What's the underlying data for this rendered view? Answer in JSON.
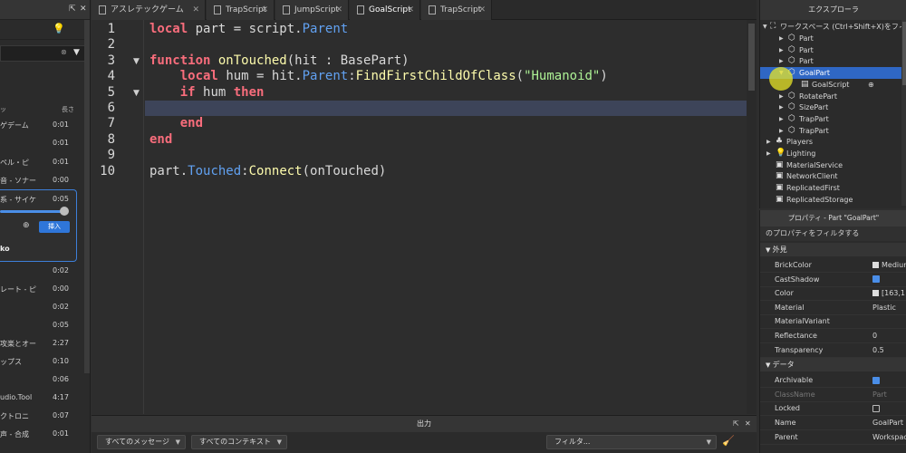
{
  "assets_panel": {
    "lightbulb_icon": "lightbulb-icon",
    "column_duration_header": "長さ",
    "column_left_header": "ッ",
    "rows": [
      {
        "title": "ゲデーム",
        "duration": "0:01"
      },
      {
        "title": "",
        "duration": "0:01"
      },
      {
        "title": "ペル・ピ",
        "duration": "0:01"
      },
      {
        "title": "音 - ソナー",
        "duration": "0:00"
      },
      {
        "title": "系 - サイケ",
        "duration": "0:05"
      }
    ],
    "selected": {
      "insert_label": "挿入",
      "author": "ko",
      "volume_fraction": 0.92
    },
    "rows_after": [
      {
        "title": "",
        "duration": "0:02"
      },
      {
        "title": "レート - ピ",
        "duration": "0:00"
      },
      {
        "title": "",
        "duration": "0:02"
      },
      {
        "title": "",
        "duration": "0:05"
      },
      {
        "title": "攻楽とオー",
        "duration": "2:27"
      },
      {
        "title": "ップス",
        "duration": "0:10"
      },
      {
        "title": "",
        "duration": "0:06"
      },
      {
        "title": "udio.Tool",
        "duration": "4:17"
      },
      {
        "title": "クトロニ",
        "duration": "0:07"
      },
      {
        "title": "声 - 合成",
        "duration": "0:01"
      }
    ]
  },
  "tabs": [
    {
      "label": "アスレテックゲーム",
      "icon": "game-icon",
      "active": false
    },
    {
      "label": "TrapScript",
      "icon": "script-icon",
      "active": false
    },
    {
      "label": "JumpScript",
      "icon": "script-icon",
      "active": false
    },
    {
      "label": "GoalScript",
      "icon": "script-icon",
      "active": true
    },
    {
      "label": "TrapScript",
      "icon": "script-icon",
      "active": false
    }
  ],
  "editor": {
    "current_line": 6,
    "line_numbers": [
      "1",
      "2",
      "3",
      "4",
      "5",
      "6",
      "7",
      "8",
      "9",
      "10"
    ],
    "lines": [
      {
        "tokens": [
          [
            "kw",
            "local"
          ],
          [
            "",
            "part = script."
          ],
          [
            "pr",
            "Parent"
          ]
        ]
      },
      {
        "tokens": []
      },
      {
        "tokens": [
          [
            "kw",
            "function"
          ],
          [
            "",
            ""
          ],
          [
            "fn",
            "onTouched"
          ],
          [
            "",
            "(hit : BasePart)"
          ]
        ]
      },
      {
        "tokens": [
          [
            "",
            "    "
          ],
          [
            "kw",
            "local"
          ],
          [
            "",
            "hum = hit."
          ],
          [
            "pr",
            "Parent"
          ],
          [
            "",
            ":"
          ],
          [
            "fn",
            "FindFirstChildOfClass"
          ],
          [
            "",
            "("
          ],
          [
            "st",
            "\"Humanoid\""
          ],
          [
            "",
            ")"
          ]
        ]
      },
      {
        "tokens": [
          [
            "",
            "    "
          ],
          [
            "kw",
            "if"
          ],
          [
            "",
            "hum "
          ],
          [
            "kw",
            "then"
          ]
        ]
      },
      {
        "tokens": []
      },
      {
        "tokens": [
          [
            "",
            "    "
          ],
          [
            "kw",
            "end"
          ]
        ]
      },
      {
        "tokens": [
          [
            "kw",
            "end"
          ]
        ]
      },
      {
        "tokens": []
      },
      {
        "tokens": [
          [
            "",
            "part."
          ],
          [
            "pr",
            "Touched"
          ],
          [
            "",
            ":"
          ],
          [
            "fn",
            "Connect"
          ],
          [
            "",
            "(onTouched)"
          ]
        ]
      }
    ]
  },
  "output": {
    "title": "出力",
    "messages_filter": "すべてのメッセージ",
    "context_filter": "すべてのコンテキスト",
    "filter_placeholder": "フィルタ..."
  },
  "explorer": {
    "title": "エクスプローラ",
    "workspace_label": "ワークスペース (Ctrl+Shift+X)をフィルタ",
    "items": [
      {
        "label": "Part",
        "icon": "part-icon"
      },
      {
        "label": "Part",
        "icon": "part-icon"
      },
      {
        "label": "Part",
        "icon": "part-icon"
      },
      {
        "label": "GoalPart",
        "icon": "part-icon",
        "selected": true
      },
      {
        "label": "GoalScript",
        "icon": "script-icon"
      },
      {
        "label": "RotatePart",
        "icon": "part-icon"
      },
      {
        "label": "SizePart",
        "icon": "part-icon"
      },
      {
        "label": "TrapPart",
        "icon": "part-icon"
      },
      {
        "label": "TrapPart",
        "icon": "part-icon"
      },
      {
        "label": "Players",
        "icon": "players-icon"
      },
      {
        "label": "Lighting",
        "icon": "lighting-icon"
      },
      {
        "label": "MaterialService",
        "icon": "material-icon"
      },
      {
        "label": "NetworkClient",
        "icon": "network-icon"
      },
      {
        "label": "ReplicatedFirst",
        "icon": "replicated-icon"
      },
      {
        "label": "ReplicatedStorage",
        "icon": "storage-icon"
      }
    ]
  },
  "properties": {
    "title": "プロパティ - Part \"GoalPart\"",
    "filter_label": "のプロパティをフィルタする",
    "sections": [
      {
        "name": "外見",
        "rows": [
          {
            "name": "BrickColor",
            "value": "Medium",
            "swatch": true
          },
          {
            "name": "CastShadow",
            "check": true
          },
          {
            "name": "Color",
            "value": "[163,1",
            "swatch": true
          },
          {
            "name": "Material",
            "value": "Plastic"
          },
          {
            "name": "MaterialVariant",
            "value": ""
          },
          {
            "name": "Reflectance",
            "value": "0"
          },
          {
            "name": "Transparency",
            "value": "0.5"
          }
        ]
      },
      {
        "name": "データ",
        "rows": [
          {
            "name": "Archivable",
            "check": true
          },
          {
            "name": "ClassName",
            "value": "Part",
            "dim": true
          },
          {
            "name": "Locked",
            "check": false
          },
          {
            "name": "Name",
            "value": "GoalPart"
          },
          {
            "name": "Parent",
            "value": "Workspac"
          }
        ]
      }
    ]
  }
}
